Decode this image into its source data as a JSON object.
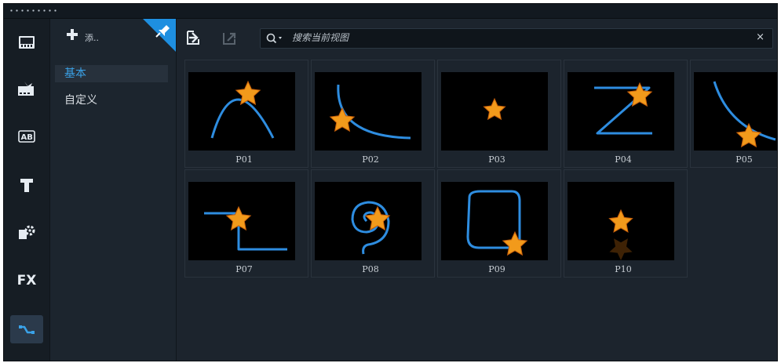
{
  "panel": {
    "add_label": "添.."
  },
  "categories": [
    {
      "label": "基本",
      "selected": true
    },
    {
      "label": "自定义",
      "selected": false
    }
  ],
  "search": {
    "placeholder": "搜索当前视图",
    "clear_label": "×"
  },
  "leftbar_icons": [
    "media-icon",
    "transition-icon",
    "title-template-icon",
    "text-icon",
    "graphics-icon",
    "fx-icon",
    "path-icon"
  ],
  "leftbar_fx_label": "FX",
  "paths": [
    {
      "label": "P01"
    },
    {
      "label": "P02"
    },
    {
      "label": "P03"
    },
    {
      "label": "P04"
    },
    {
      "label": "P05"
    },
    {
      "label": "P07"
    },
    {
      "label": "P08"
    },
    {
      "label": "P09"
    },
    {
      "label": "P10"
    }
  ],
  "colors": {
    "accent": "#3aa2e8",
    "path_line": "#2e8de0",
    "star": "#f29a1b",
    "background": "#1c242d"
  }
}
